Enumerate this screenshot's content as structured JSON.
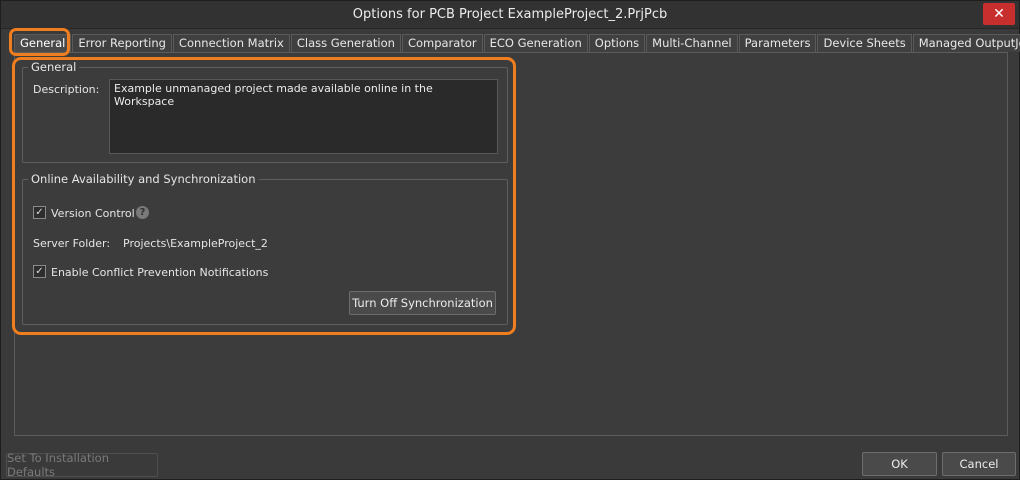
{
  "window": {
    "title": "Options for PCB Project ExampleProject_2.PrjPcb",
    "close_glyph": "✕"
  },
  "tabs": [
    {
      "label": "General",
      "active": true
    },
    {
      "label": "Error Reporting"
    },
    {
      "label": "Connection Matrix"
    },
    {
      "label": "Class Generation"
    },
    {
      "label": "Comparator"
    },
    {
      "label": "ECO Generation"
    },
    {
      "label": "Options"
    },
    {
      "label": "Multi-Channel"
    },
    {
      "label": "Parameters"
    },
    {
      "label": "Device Sheets"
    },
    {
      "label": "Managed OutputJobs"
    }
  ],
  "general": {
    "group_title": "General",
    "description_label": "Description:",
    "description_value": "Example unmanaged project made available online in the Workspace"
  },
  "online": {
    "group_title": "Online Availability and Synchronization",
    "version_control_label": "Version Control",
    "version_control_checked": true,
    "help_glyph": "?",
    "server_folder_label": "Server Folder:",
    "server_folder_value": "Projects\\ExampleProject_2",
    "conflict_label": "Enable Conflict Prevention Notifications",
    "conflict_checked": true,
    "sync_button": "Turn Off Synchronization"
  },
  "footer": {
    "defaults_button": "Set To Installation Defaults",
    "ok_button": "OK",
    "cancel_button": "Cancel"
  },
  "colors": {
    "accent_highlight": "#f07d1e",
    "close_red": "#c72e2e"
  },
  "checkmark": "✓"
}
